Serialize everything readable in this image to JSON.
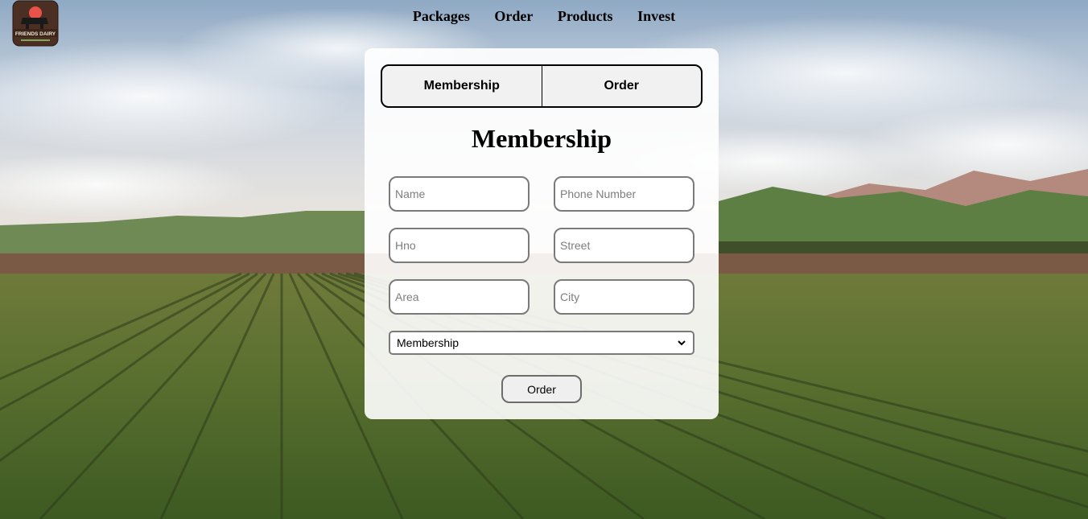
{
  "brand": {
    "logo_text": "FRIENDS DAIRY"
  },
  "nav": {
    "items": [
      "Packages",
      "Order",
      "Products",
      "Invest"
    ]
  },
  "form": {
    "tabs": [
      "Membership",
      "Order"
    ],
    "title": "Membership",
    "fields": {
      "name": {
        "placeholder": "Name"
      },
      "phone": {
        "placeholder": "Phone Number"
      },
      "hno": {
        "placeholder": "Hno"
      },
      "street": {
        "placeholder": "Street"
      },
      "area": {
        "placeholder": "Area"
      },
      "city": {
        "placeholder": "City"
      }
    },
    "select": {
      "selected": "Membership"
    },
    "submit_label": "Order"
  },
  "icons": {
    "logo": "cow-logo-icon",
    "select_arrow": "chevron-down-icon"
  },
  "colors": {
    "card_bg": "#ffffff",
    "field_border": "#7a7a7a",
    "text": "#000000"
  }
}
